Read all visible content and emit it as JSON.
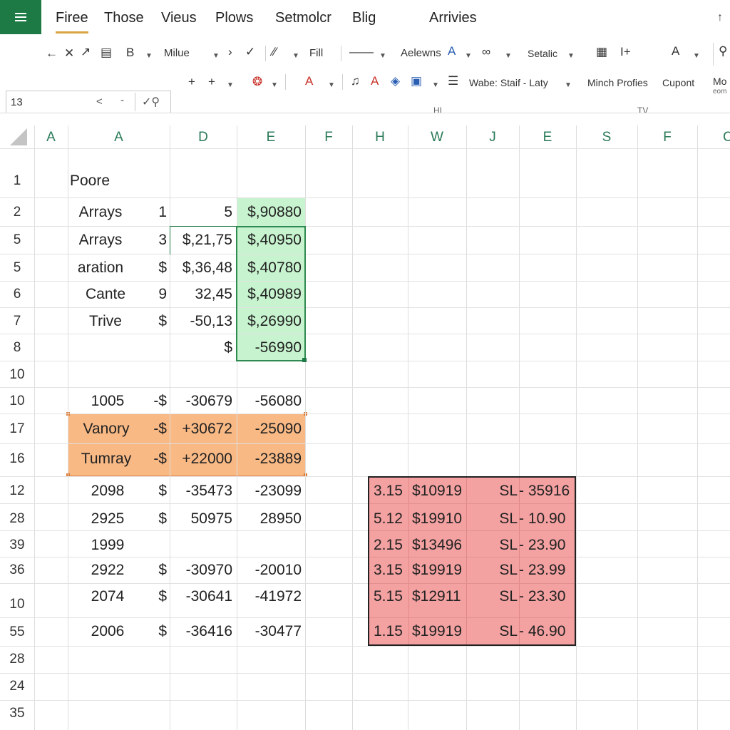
{
  "menubar": {
    "tabs": [
      "Firee",
      "Those",
      "Vieus",
      "Plows",
      "Setmolcr",
      "Blig",
      "Arrivies"
    ],
    "logo_icon": "spreadsheet-list-icon",
    "collapse_icon": "chevron-up-icon"
  },
  "ribbon": {
    "row1": {
      "font_name": "Milue",
      "fill_label": "Fill",
      "arrange_label": "Aelewns",
      "style_label": "Setalic"
    },
    "row2": {
      "plus_label": "+",
      "style_dropdown": "Wabe: Staif - Laty",
      "group_minch": "Minch Profies",
      "group_cupont": "Cupont",
      "group_more": "Mo",
      "group_more_sub": "eom"
    },
    "group_labels": {
      "hi": "HI",
      "tv": "TV"
    }
  },
  "name_box": {
    "value": "13",
    "caret": "<",
    "dash": "-"
  },
  "columns": [
    "A",
    "A",
    "D",
    "E",
    "F",
    "H",
    "W",
    "J",
    "E",
    "S",
    "F",
    "C"
  ],
  "rows": [
    "1",
    "2",
    "5",
    "5",
    "6",
    "7",
    "8",
    "10",
    "10",
    "17",
    "16",
    "12",
    "28",
    "39",
    "36",
    "10",
    "55",
    "28",
    "24",
    "35"
  ],
  "cells": {
    "r1": {
      "a": "Poore"
    },
    "r2": {
      "a": "Arrays",
      "b": "1",
      "d": "5",
      "e": "$,90880"
    },
    "r3": {
      "a": "Arrays",
      "b": "3",
      "d": "$,21,75",
      "e": "$,40950"
    },
    "r4": {
      "a": "aration",
      "b": "$",
      "d": "$,36,48",
      "e": "$,40780"
    },
    "r5": {
      "a": "Cante",
      "b": "9",
      "d": "32,45",
      "e": "$,40989"
    },
    "r6": {
      "a": "Trive",
      "b": "$",
      "d": "-50,13",
      "e": "$,26990"
    },
    "r7": {
      "d": "$",
      "e": "-56990"
    },
    "r9": {
      "a": "1005",
      "b": "-$",
      "d": "-30679",
      "e": "-56080"
    },
    "r10": {
      "a": "Vanory",
      "b": "-$",
      "d": "+30672",
      "e": "-25090"
    },
    "r11": {
      "a": "Tumray",
      "b": "-$",
      "d": "+22000",
      "e": "-23889"
    },
    "r12": {
      "a": "2098",
      "b": "$",
      "d": "-35473",
      "e": "-23099"
    },
    "r13": {
      "a": "2925",
      "b": "$",
      "d": "50975",
      "e": "28950"
    },
    "r14": {
      "a": "1999"
    },
    "r15": {
      "a": "2922",
      "b": "$",
      "d": "-30970",
      "e": "-20010"
    },
    "r16": {
      "a": "2074",
      "b": "$",
      "d": "-30641",
      "e": "-41972"
    },
    "r17": {
      "a": "2006",
      "b": "$",
      "d": "-36416",
      "e": "-30477"
    }
  },
  "red_table": [
    {
      "h": "3.15",
      "w": "$10919",
      "j": "SL",
      "e": "- 35916"
    },
    {
      "h": "5.12",
      "w": "$19910",
      "j": "SL",
      "e": "- 10.90"
    },
    {
      "h": "2.15",
      "w": "$13496",
      "j": "SL",
      "e": "- 23.90"
    },
    {
      "h": "3.15",
      "w": "$19919",
      "j": "SL",
      "e": "- 23.99"
    },
    {
      "h": "5.15",
      "w": "$12911",
      "j": "SL",
      "e": "- 23.30"
    },
    {
      "h": "1.15",
      "w": "$19919",
      "j": "SL",
      "e": "- 46.90"
    }
  ],
  "colors": {
    "brand": "#1e7a45",
    "green_fill": "#c7f4cf",
    "orange_fill": "#f8b985",
    "red_fill": "#f4a1a1"
  }
}
